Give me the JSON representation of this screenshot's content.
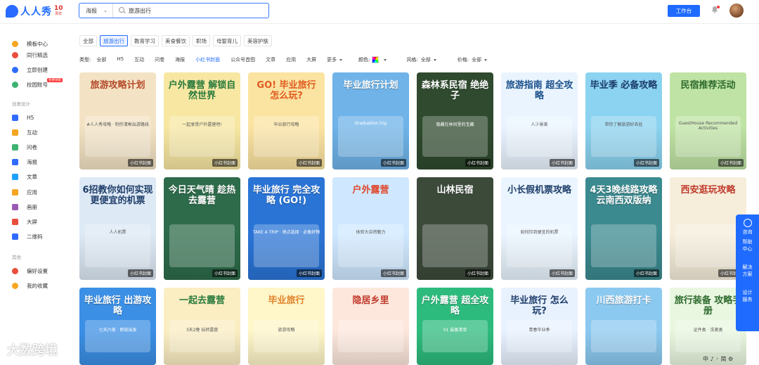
{
  "header": {
    "logo_text": "人人秀",
    "anniversary_number": "10",
    "anniversary_unit": "周年",
    "search_scope": "海报",
    "search_value": "旅游出行",
    "workbench_label": "工作台"
  },
  "sidebar": {
    "top_items": [
      {
        "label": "模板中心",
        "color": "#f5a623"
      },
      {
        "label": "同行精选",
        "color": "#e94e3d"
      },
      {
        "label": "立即创建",
        "color": "#2f6bff"
      },
      {
        "label": "校园账号",
        "color": "#3cb371",
        "new_tag": "免费领取"
      }
    ],
    "section_create": "创意设计",
    "create_items": [
      {
        "label": "H5",
        "color": "#2f6bff"
      },
      {
        "label": "互动",
        "color": "#f5a623"
      },
      {
        "label": "问卷",
        "color": "#3cb371"
      },
      {
        "label": "海报",
        "color": "#2f6bff"
      },
      {
        "label": "文章",
        "color": "#1fa2ff"
      },
      {
        "label": "应用",
        "color": "#f5a623"
      },
      {
        "label": "画册",
        "color": "#9b59b6"
      },
      {
        "label": "大屏",
        "color": "#e94e3d"
      },
      {
        "label": "二维码",
        "color": "#2f6bff"
      }
    ],
    "section_other": "其他",
    "other_items": [
      {
        "label": "偏好设置",
        "color": "#e94e3d"
      },
      {
        "label": "我的收藏",
        "color": "#f5a623"
      }
    ]
  },
  "tabs": [
    "全部",
    "旅游出行",
    "教育学习",
    "美食餐饮",
    "职场",
    "母婴育儿",
    "美容护肤"
  ],
  "active_tab": 1,
  "filters": {
    "type_label": "类型:",
    "types": [
      "全部",
      "H5",
      "互动",
      "问卷",
      "海报",
      "小红书封面",
      "公众号首图",
      "文章",
      "应用",
      "大屏"
    ],
    "active_type": 5,
    "more": "更多",
    "color_label": "颜色:",
    "style_label": "风格:",
    "style_value": "全部",
    "price_label": "价格:",
    "price_value": "全部"
  },
  "card_tag": "小红书封面",
  "cards": [
    {
      "title": "旅游攻略计划",
      "sub": "#人人秀攻略 · 制作清晰出游路线",
      "bg": "#f3e3c4",
      "fg": "#b44a2a"
    },
    {
      "title": "户外露营 解锁自然世界",
      "sub": "一起享受户外露营吧!",
      "bg": "#f7e7a2",
      "fg": "#2b7a3c"
    },
    {
      "title": "GO! 毕业旅行 怎么玩?",
      "sub": "毕业旅行攻略",
      "bg": "#fbe3a1",
      "fg": "#e05a1f"
    },
    {
      "title": "毕业旅行计划",
      "sub": "Graduation trip",
      "bg": "#6fb3e8",
      "fg": "#ffffff"
    },
    {
      "title": "森林系民宿 绝绝子",
      "sub": "隐藏在林间里的宝藏",
      "bg": "#2f4a2e",
      "fg": "#ffffff"
    },
    {
      "title": "旅游指南 超全攻略",
      "sub": "人少景美",
      "bg": "#eaf4ff",
      "fg": "#1a4f8a"
    },
    {
      "title": "毕业季 必备攻略",
      "sub": "带你了解旅游好去处",
      "bg": "#8bd3f0",
      "fg": "#1a3a6a"
    },
    {
      "title": "民宿推荐活动",
      "sub": "GuestHouse Recommended Activities",
      "bg": "#bfe3a4",
      "fg": "#2d6a2d"
    },
    {
      "title": "6招教你如何实现更便宜的机票",
      "sub": "人人机票",
      "bg": "#dde9f5",
      "fg": "#1f3e6a"
    },
    {
      "title": "今日天气晴 趁热去露营",
      "sub": "",
      "bg": "#2d6b4a",
      "fg": "#ffffff"
    },
    {
      "title": "毕业旅行 完全攻略 (GO!)",
      "sub": "TAKE A TRIP · 地点选择 · 必备好物",
      "bg": "#2a74d6",
      "fg": "#ffffff"
    },
    {
      "title": "户外露营",
      "sub": "体验大自然魅力",
      "bg": "#cfe8ff",
      "fg": "#e0462a"
    },
    {
      "title": "山林民宿",
      "sub": "",
      "bg": "#3c4a3a",
      "fg": "#ffffff"
    },
    {
      "title": "小长假机票攻略",
      "sub": "如何捡到便宜的机票",
      "bg": "#eaf5ff",
      "fg": "#1f3e6a"
    },
    {
      "title": "4天3晚线路攻略 云南西双版纳",
      "sub": "",
      "bg": "#3b8a8f",
      "fg": "#ffffff"
    },
    {
      "title": "西安逛玩攻略",
      "sub": "",
      "bg": "#f6eedb",
      "fg": "#c0392b"
    },
    {
      "title": "毕业旅行 出游攻略",
      "sub": "七天六夜 · 即刻出发",
      "bg": "#3b8fe5",
      "fg": "#ffffff"
    },
    {
      "title": "一起去露营",
      "sub": "3天2晚 玩转露营",
      "bg": "#fbeec3",
      "fg": "#2b7a3c"
    },
    {
      "title": "毕业旅行",
      "sub": "旅游攻略",
      "bg": "#fff6c9",
      "fg": "#e0822a"
    },
    {
      "title": "隐居乡里",
      "sub": "",
      "bg": "#fde7dc",
      "fg": "#c0392b"
    },
    {
      "title": "户外露营 超全攻略",
      "sub": "01 装备清单",
      "bg": "#2dbb7d",
      "fg": "#ffffff"
    },
    {
      "title": "毕业旅行 怎么玩?",
      "sub": "青春毕业季",
      "bg": "#e8f2ff",
      "fg": "#1f3e6a"
    },
    {
      "title": "川西旅游打卡",
      "sub": "",
      "bg": "#8cc9f0",
      "fg": "#ffffff"
    },
    {
      "title": "旅行装备 攻略手册",
      "sub": "证件类 · 洗漱类",
      "bg": "#e9f7e0",
      "fg": "#2d6a2d"
    }
  ],
  "float_panel": [
    "咨询",
    "帮助中心",
    "解决方案",
    "设计服务"
  ],
  "watermark": "大数跨境",
  "bottom_tools": "中 ♪ ◦ 简 ⚙"
}
